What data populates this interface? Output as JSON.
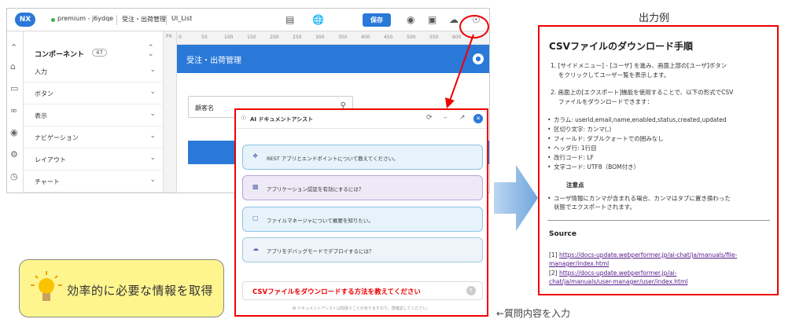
{
  "editor": {
    "logo_text": "NX",
    "env": "premium - j6ydqe",
    "app_name": "受注・出荷管理",
    "page_name": "UI_List",
    "save_label": "保存",
    "ruler_unit": "PX",
    "ruler_ticks": [
      "0",
      "50",
      "100",
      "150",
      "200",
      "250",
      "300",
      "350",
      "400",
      "450",
      "500",
      "550",
      "600"
    ],
    "panel_title": "コンポーネント",
    "panel_count": "47",
    "panel_items": [
      "入力",
      "ボタン",
      "表示",
      "ナビゲーション",
      "レイアウト",
      "チャート"
    ],
    "canvas_title": "受注・出荷管理",
    "search_label": "顧客名"
  },
  "assist": {
    "title": "AI ドキュメントアシスト",
    "suggestions": [
      "REST アプリとエンドポイントについて教えてください。",
      "アプリケーション認証を有効にするには？",
      "ファイルマネージャについて概要を知りたい。",
      "アプリをデバッグモードでデプロイするには？"
    ],
    "question": "CSVファイルをダウンロードする方法を教えてください",
    "disclaimer": "AI ドキュメントアシストは間違うことがありますので、再確認してください。"
  },
  "callout": {
    "text": "効率的に必要な情報を取得"
  },
  "input_note": "←質問内容を入力",
  "output": {
    "label": "出力例",
    "title": "CSVファイルのダウンロード手順",
    "step1_l1": "1. [サイドメニュー] - [ユーザ] を進み、画面上部の[ユーザ]ボタン",
    "step1_l2": "をクリックしてユーザー覧を表示します。",
    "step2_l1": "2. 画面上の[エクスポート]機能を使用することで、以下の形式でCSV",
    "step2_l2": "ファイルをダウンロードできます：",
    "bullets": [
      "カラム: userid,email,name,enabled,status,created,updated",
      "区切り文字: カンマ(,)",
      "フィールド: ダブルクォートでの囲みなし",
      "ヘッダ行: 1行目",
      "改行コード: LF",
      "文字コード: UTF8（BOM付き）"
    ],
    "note_heading": "注意点",
    "note_l1": "ユーザ情報にカンマが含まれる場合、カンマはタブに置き換わった",
    "note_l2": "状態でエクスポートされます。",
    "source_heading": "Source",
    "source1_prefix": "[1] ",
    "source1_l1": "https://docs-update.webperformer.jp/ai-chat/ja/manuals/file-",
    "source1_l2": "manager/index.html",
    "source2_prefix": "[2] ",
    "source2_l1": "https://docs-update.webperformer.jp/ai-",
    "source2_l2": "chat/ja/manuals/user-manager/user/index.html"
  }
}
